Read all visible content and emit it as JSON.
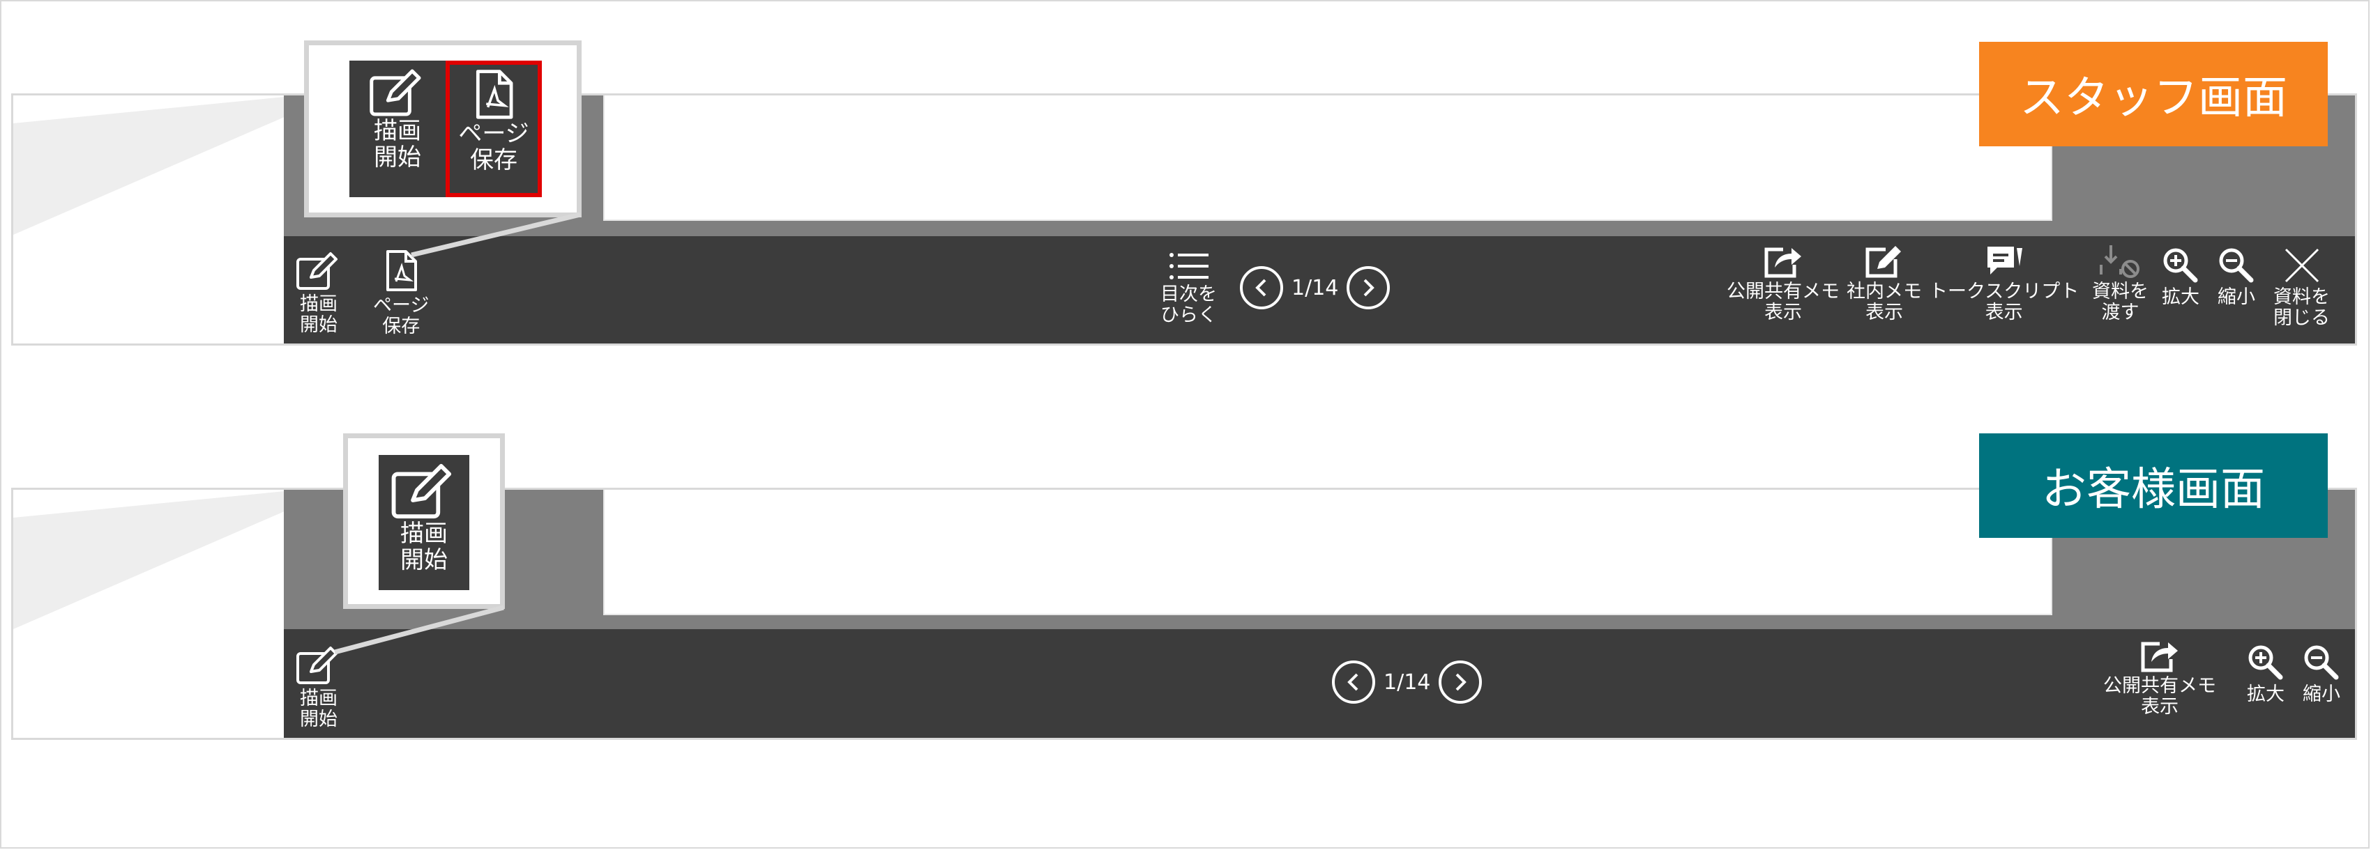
{
  "staff": {
    "badge": "スタッフ画面",
    "toolbar": {
      "draw": "描画\n開始",
      "save_page": "ページ\n保存",
      "toc": "目次を\nひらく",
      "page": "1/14",
      "public_memo": "公開共有メモ\n表示",
      "internal_memo": "社内メモ\n表示",
      "talk_script": "トークスクリプト\n表示",
      "hand_over": "資料を\n渡す",
      "zoom_in": "拡大",
      "zoom_out": "縮小",
      "close": "資料を\n閉じる"
    },
    "callout": {
      "draw": "描画\n開始",
      "save_page": "ページ\n保存"
    }
  },
  "customer": {
    "badge": "お客様画面",
    "toolbar": {
      "draw": "描画\n開始",
      "page": "1/14",
      "public_memo": "公開共有メモ\n表示",
      "zoom_in": "拡大",
      "zoom_out": "縮小"
    },
    "callout": {
      "draw": "描画\n開始"
    }
  },
  "colors": {
    "staff_badge": "#f7841f",
    "customer_badge": "#00737f",
    "toolbar": "#3c3c3c",
    "highlight": "#e00000"
  }
}
